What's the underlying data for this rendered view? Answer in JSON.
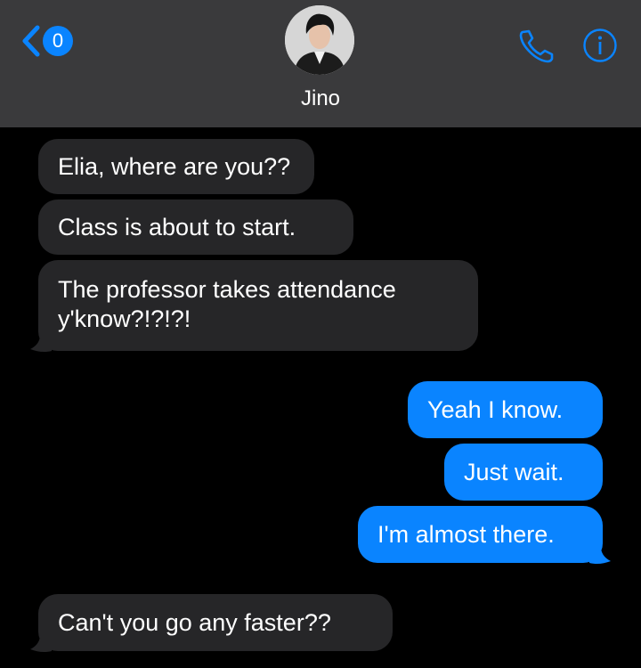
{
  "header": {
    "back_badge": "0",
    "contact_name": "Jino"
  },
  "messages": [
    {
      "side": "in",
      "lines": [
        "Elia, where are you??"
      ]
    },
    {
      "side": "in",
      "lines": [
        "Class is about to start."
      ]
    },
    {
      "side": "in",
      "lines": [
        "The professor takes attendance",
        "y'know?!?!?!"
      ]
    },
    {
      "side": "out",
      "lines": [
        "Yeah I know."
      ]
    },
    {
      "side": "out",
      "lines": [
        "Just wait."
      ]
    },
    {
      "side": "out",
      "lines": [
        "I'm almost there."
      ]
    },
    {
      "side": "in",
      "lines": [
        "Can't you go any faster??"
      ]
    }
  ],
  "colors": {
    "header_bg": "#3a3a3c",
    "incoming_bubble": "#262628",
    "outgoing_bubble": "#0a84ff",
    "accent": "#0a84ff"
  },
  "icons": [
    "back-chevron-icon",
    "phone-icon",
    "info-icon"
  ]
}
